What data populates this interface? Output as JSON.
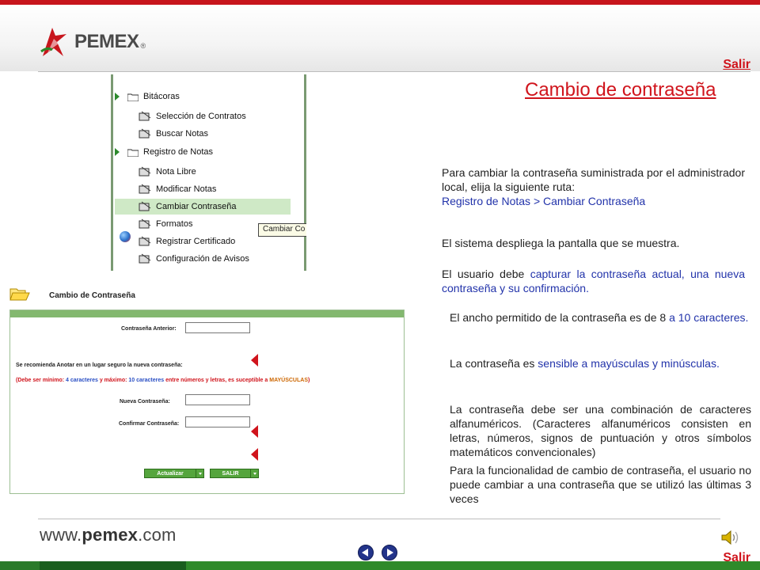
{
  "header": {
    "brand": "PEMEX",
    "brand_mark": "®",
    "salir": "Salir"
  },
  "page": {
    "title": "Cambio de contraseña"
  },
  "menu": {
    "items": [
      {
        "label": "Bitácoras"
      },
      {
        "label": "Selección de Contratos"
      },
      {
        "label": "Buscar Notas"
      },
      {
        "label": "Registro de Notas"
      },
      {
        "label": "Nota Libre"
      },
      {
        "label": "Modificar Notas"
      },
      {
        "label": "Cambiar Contraseña"
      },
      {
        "label": "Formatos"
      },
      {
        "label": "Registrar Certificado"
      },
      {
        "label": "Configuración de Avisos"
      }
    ],
    "tooltip": "Cambiar Co"
  },
  "form": {
    "title": "Cambio de Contraseña",
    "previous_label": "Contraseña Anterior:",
    "recommendation": "Se recomienda Anotar en un lugar seguro la nueva contraseña:",
    "rule_part1": "(Debe ser mínimo: ",
    "rule_min": "4 caracteres",
    "rule_part2": " y  máximo: ",
    "rule_max": "10 caracteres",
    "rule_part3": "  entre números y letras,  es suceptible a ",
    "rule_caps": "MAYÚSCULAS",
    "rule_end": ")",
    "new_label": "Nueva Contraseña:",
    "confirm_label": "Confirmar Contraseña:",
    "update_button": "Actualizar",
    "exit_button": "SALIR"
  },
  "text": {
    "p1": "Para cambiar la contraseña suministrada por el administrador local, elija la siguiente ruta:",
    "p1_route": "Registro de Notas > Cambiar Contraseña",
    "p2": "El sistema despliega la pantalla que se muestra.",
    "p3_a": "El usuario debe ",
    "p3_b": "capturar la contraseña actual, una nueva contraseña y su confirmación.",
    "p4_a": "El ancho permitido de la contraseña es de 8 ",
    "p4_b": "a 10 caracteres.",
    "p5_a": "La contraseña es ",
    "p5_b": "sensible a mayúsculas y minúsculas.",
    "p6": "La contraseña debe ser una combinación de caracteres alfanuméricos. (Caracteres alfanuméricos consisten en letras, números, signos de puntuación y otros símbolos matemáticos convencionales)",
    "p7": "Para la funcionalidad de cambio de contraseña,  el usuario no puede cambiar a una contraseña que se utilizó las últimas 3 veces"
  },
  "footer": {
    "url_prefix": "www.",
    "url_bold": "pemex",
    "url_suffix": ".com",
    "salir": "Salir"
  },
  "colors": {
    "accent_red": "#d0141c",
    "pemex_green": "#1a7a2e",
    "link_blue": "#2233aa"
  },
  "icons": {
    "prev": "arrow-left-icon",
    "next": "arrow-right-icon",
    "speaker": "speaker-icon"
  }
}
